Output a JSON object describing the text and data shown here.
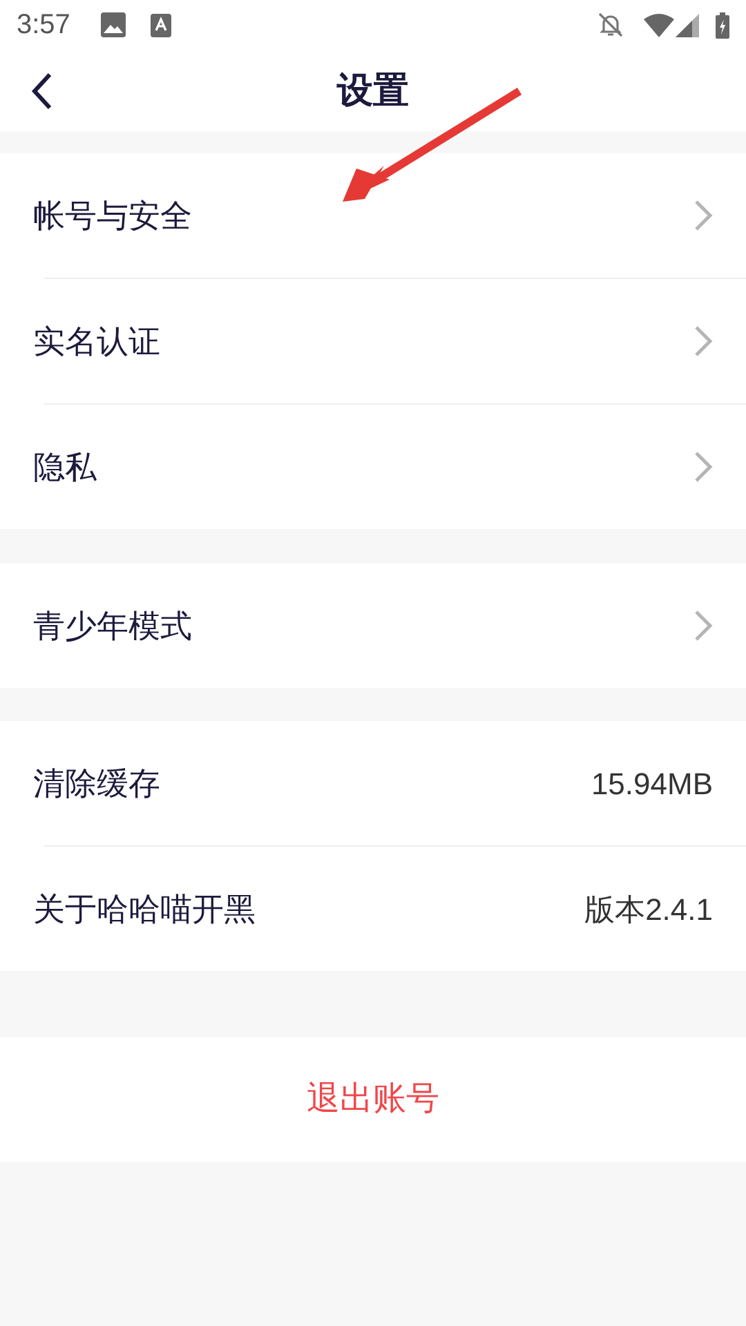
{
  "status_bar": {
    "time": "3:57"
  },
  "header": {
    "title": "设置"
  },
  "groups": [
    {
      "rows": [
        {
          "kind": "link",
          "label": "帐号与安全"
        },
        {
          "kind": "link",
          "label": "实名认证"
        },
        {
          "kind": "link",
          "label": "隐私"
        }
      ]
    },
    {
      "rows": [
        {
          "kind": "link",
          "label": "青少年模式"
        }
      ]
    },
    {
      "rows": [
        {
          "kind": "value",
          "label": "清除缓存",
          "value": "15.94MB"
        },
        {
          "kind": "value",
          "label": "关于哈哈喵开黑",
          "value": "版本2.4.1"
        }
      ]
    }
  ],
  "logout_button": "退出账号"
}
